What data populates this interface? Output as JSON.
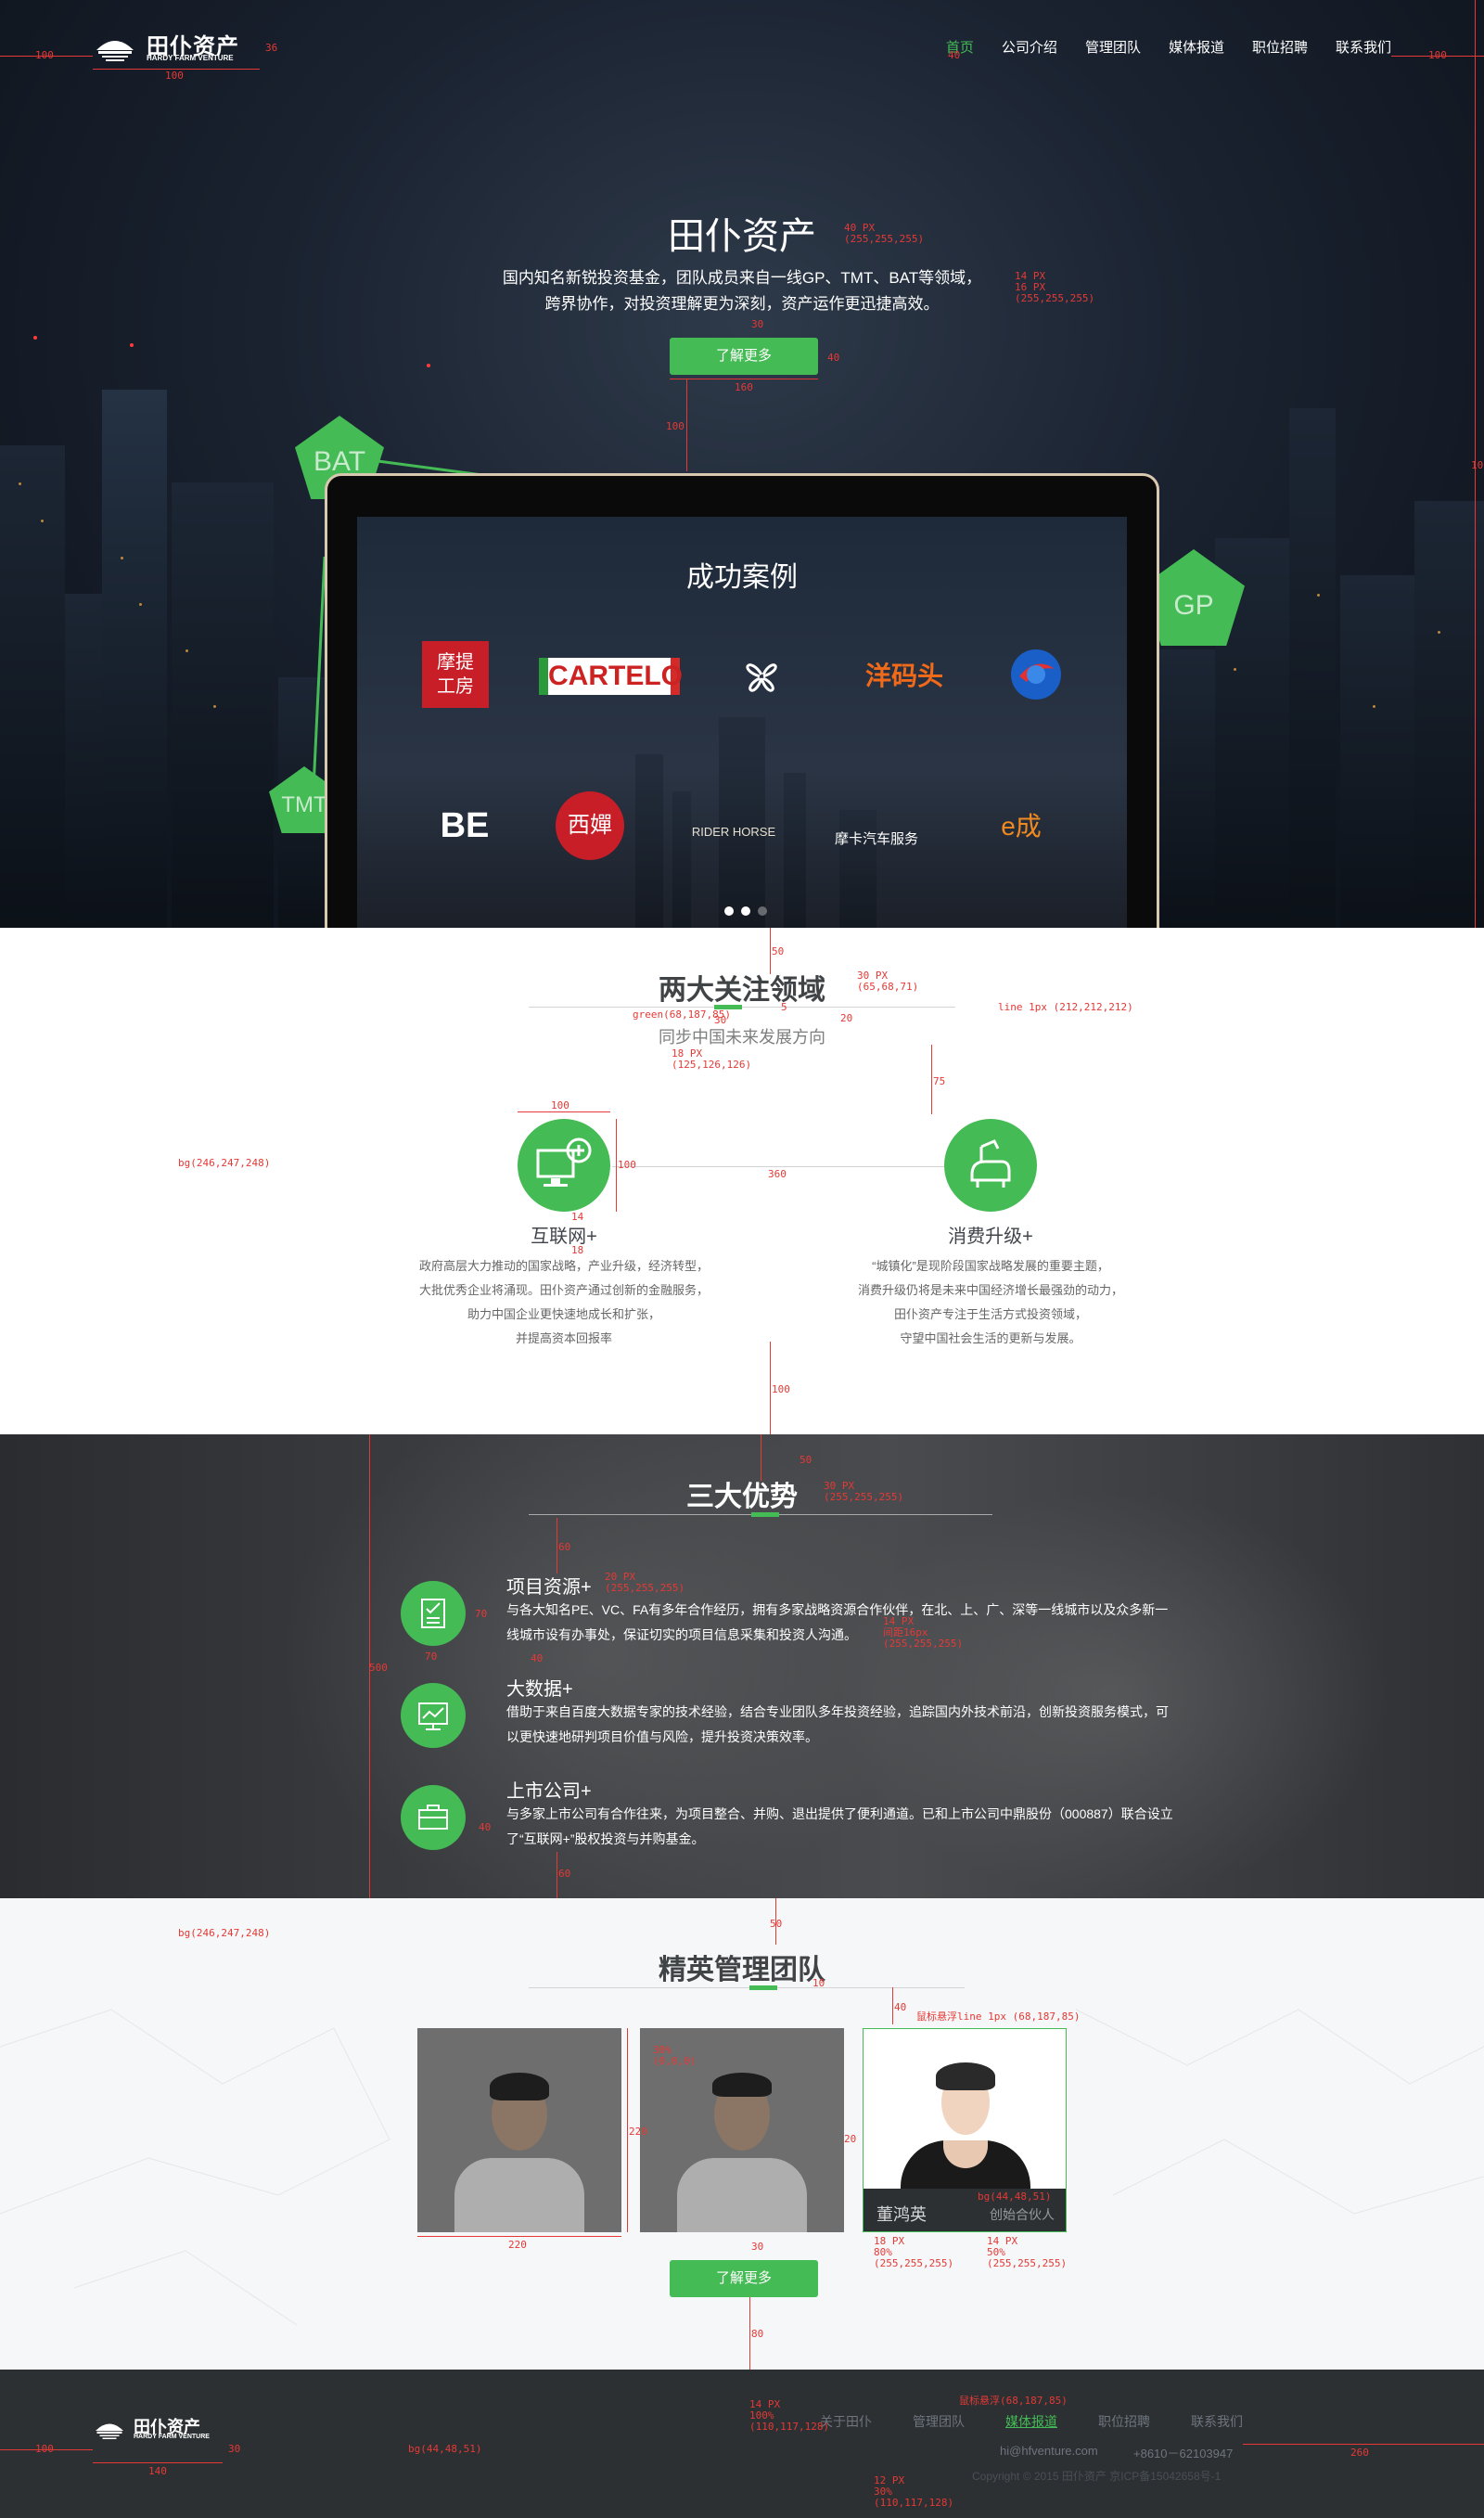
{
  "brand": {
    "logo_cn": "田仆资产",
    "logo_en": "HARDY FARM VENTURE"
  },
  "nav": {
    "items": [
      "首页",
      "公司介绍",
      "管理团队",
      "媒体报道",
      "职位招聘",
      "联系我们"
    ],
    "active_index": 0
  },
  "hero": {
    "title": "田仆资产",
    "desc_line1": "国内知名新锐投资基金，团队成员来自一线GP、TMT、BAT等领域，",
    "desc_line2": "跨界协作，对投资理解更为深刻，资产运作更迅捷高效。",
    "button": "了解更多",
    "badges": [
      "BAT",
      "GP",
      "TMT"
    ]
  },
  "cases": {
    "title": "成功案例",
    "logos": [
      {
        "name": "motivate-logo",
        "text": "摩提工房"
      },
      {
        "name": "cartelo-logo",
        "text": "CARTELO"
      },
      {
        "name": "clover-logo",
        "text": ""
      },
      {
        "name": "yangmatou-logo",
        "text": "洋码头"
      },
      {
        "name": "orb-logo",
        "text": ""
      },
      {
        "name": "be-education-logo",
        "text": "BE"
      },
      {
        "name": "xichan-logo",
        "text": "西嬋"
      },
      {
        "name": "rider-horse-logo",
        "text": "RIDER HORSE"
      },
      {
        "name": "mocar-logo",
        "text": "摩卡汽车服务"
      },
      {
        "name": "echeng-logo",
        "text": "e成"
      }
    ],
    "slides": 3,
    "active_slide": 1
  },
  "focus": {
    "title": "两大关注领域",
    "subtitle": "同步中国未来发展方向",
    "items": [
      {
        "title": "互联网+",
        "lines": [
          "政府高层大力推动的国家战略，产业升级，经济转型，",
          "大批优秀企业将涌现。田仆资产通过创新的金融服务，",
          "助力中国企业更快速地成长和扩张，",
          "并提高资本回报率"
        ]
      },
      {
        "title": "消费升级+",
        "lines": [
          "“城镇化”是现阶段国家战略发展的重要主题，",
          "消费升级仍将是未来中国经济增长最强劲的动力，",
          "田仆资产专注于生活方式投资领域，",
          "守望中国社会生活的更新与发展。"
        ]
      }
    ]
  },
  "advantages": {
    "title": "三大优势",
    "items": [
      {
        "title": "项目资源+",
        "desc": "与各大知名PE、VC、FA有多年合作经历，拥有多家战略资源合作伙伴，在北、上、广、深等一线城市以及众多新一线城市设有办事处，保证切实的项目信息采集和投资人沟通。"
      },
      {
        "title": "大数据+",
        "desc": "借助于来自百度大数据专家的技术经验，结合专业团队多年投资经验，追踪国内外技术前沿，创新投资服务模式，可以更快速地研判项目价值与风险，提升投资决策效率。"
      },
      {
        "title": "上市公司+",
        "desc": "与多家上市公司有合作往来，为项目整合、并购、退出提供了便利通道。已和上市公司中鼎股份（000887）联合设立了“互联网+”股权投资与并购基金。"
      }
    ]
  },
  "team": {
    "title": "精英管理团队",
    "members": [
      {
        "name": "",
        "role": ""
      },
      {
        "name": "",
        "role": ""
      },
      {
        "name": "董鸿英",
        "role": "创始合伙人"
      }
    ],
    "button": "了解更多"
  },
  "footer": {
    "links": [
      "关于田仆",
      "管理团队",
      "媒体报道",
      "职位招聘",
      "联系我们"
    ],
    "active_index": 2,
    "email": "hi@hfventure.com",
    "phone": "+8610－62103947",
    "copyright": "Copyright © 2015 田仆资产 京ICP备15042658号-1"
  },
  "annotations": {
    "a_100_left": "100",
    "a_36": "36",
    "a_100_logo": "100",
    "a_40_nav": "40",
    "a_100_right": "100",
    "a_title_spec": "40 PX\n(255,255,255)",
    "a_desc_spec": "14 PX\n16 PX\n(255,255,255)",
    "a_30_btn": "30",
    "a_40_btn": "40",
    "a_160": "160",
    "a_100_btn_gap": "100",
    "a_100_edge": "100",
    "a_50_focus": "50",
    "a_focus_title_spec": "30 PX\n(65,68,71)",
    "a_5": "5",
    "a_30_bar": "30",
    "a_20_sub": "20",
    "a_green": "green(68,187,85)",
    "a_line": "line 1px (212,212,212)",
    "a_sub_spec": "18 PX\n(125,126,126)",
    "a_75": "75",
    "a_bg1": "bg(246,247,248)",
    "a_100_icon_w": "100",
    "a_100_icon_h": "100",
    "a_360": "360",
    "a_14": "14",
    "a_18": "18",
    "a_100_gap": "100",
    "a_50_adv": "50",
    "a_adv_title_spec": "30 PX\n(255,255,255)",
    "a_60_top": "60",
    "a_adv_item_spec": "20 PX\n(255,255,255)",
    "a_70_icon": "70",
    "a_adv_desc_spec": "14 PX\n间距16px\n(255,255,255)",
    "a_40_adv": "40",
    "a_500": "500",
    "a_70_w": "70",
    "a_40_icon_gap": "40",
    "a_60_bottom": "60",
    "a_50_team": "50",
    "a_bg2": "bg(246,247,248)",
    "a_10_team": "10",
    "a_40_team": "40",
    "a_hover_line": "鼠标悬浮line 1px (68,187,85)",
    "a_photo_overlay": "30%\n(0,0,0)",
    "a_220_h": "220",
    "a_20_gap": "20",
    "a_220_w": "220",
    "a_caption_bg": "bg(44,48,51)",
    "a_name_spec": "18 PX\n80%\n(255,255,255)",
    "a_role_spec": "14 PX\n50%\n(255,255,255)",
    "a_30_team_btn": "30",
    "a_80": "80",
    "a_foot_link_spec": "14 PX\n100%\n(110,117,128)",
    "a_foot_hover": "鼠标悬浮(68,187,85)",
    "a_100_foot": "100",
    "a_30_foot": "30",
    "a_140": "140",
    "a_bg3": "bg(44,48,51)",
    "a_260": "260",
    "a_copy_spec": "12 PX\n30%\n(110,117,128)"
  }
}
